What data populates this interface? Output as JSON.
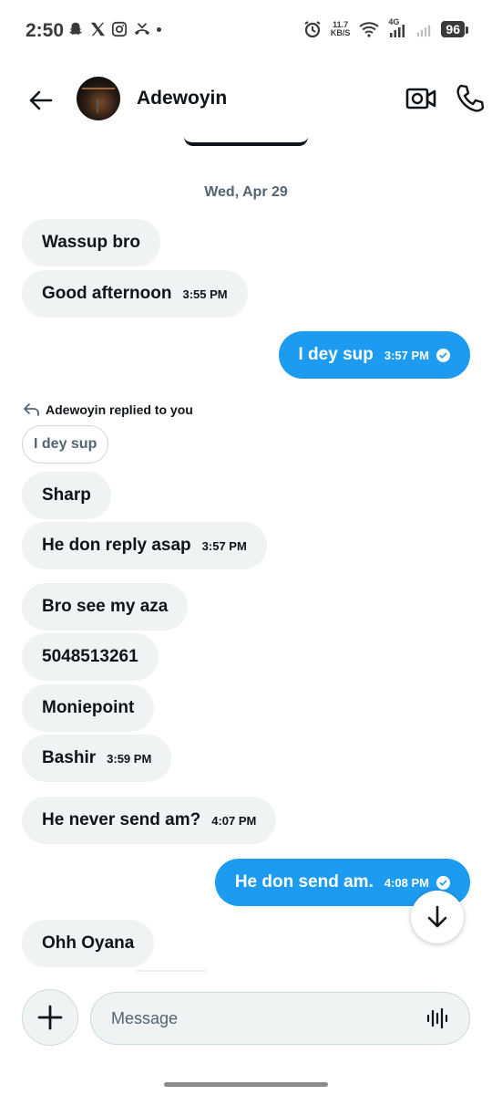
{
  "status_bar": {
    "time": "2:50",
    "net_speed_value": "11.7",
    "net_speed_unit": "KB/S",
    "network_type": "4G",
    "battery": "96"
  },
  "header": {
    "contact_name": "Adewoyin"
  },
  "conversation": {
    "date_separator": "Wed, Apr 29",
    "replied_notice": "Adewoyin replied to you",
    "reply_quote": "I dey sup",
    "messages": [
      {
        "text": "Wassup bro",
        "time": ""
      },
      {
        "text": "Good afternoon",
        "time": "3:55 PM"
      },
      {
        "text": "I dey sup",
        "time": "3:57 PM"
      },
      {
        "text": "Sharp",
        "time": ""
      },
      {
        "text": "He don reply asap",
        "time": "3:57 PM"
      },
      {
        "text": "Bro see my aza",
        "time": ""
      },
      {
        "text": "5048513261",
        "time": ""
      },
      {
        "text": "Moniepoint",
        "time": ""
      },
      {
        "text": "Bashir",
        "time": "3:59 PM"
      },
      {
        "text": "He never send am?",
        "time": "4:07 PM"
      },
      {
        "text": "He don send am.",
        "time": "4:08 PM"
      },
      {
        "text": "Ohh Oyana",
        "time": ""
      }
    ]
  },
  "composer": {
    "placeholder": "Message"
  },
  "colors": {
    "accent": "#1d9bf0",
    "incoming_bubble": "#eff3f4",
    "muted_text": "#536471"
  },
  "icons": {
    "back": "arrow-left-icon",
    "video": "video-camera-icon",
    "call": "phone-icon",
    "read": "check-circle-icon",
    "reply": "reply-arrow-icon",
    "scroll_down": "arrow-down-icon",
    "add": "plus-icon",
    "voice": "voice-wave-icon"
  }
}
